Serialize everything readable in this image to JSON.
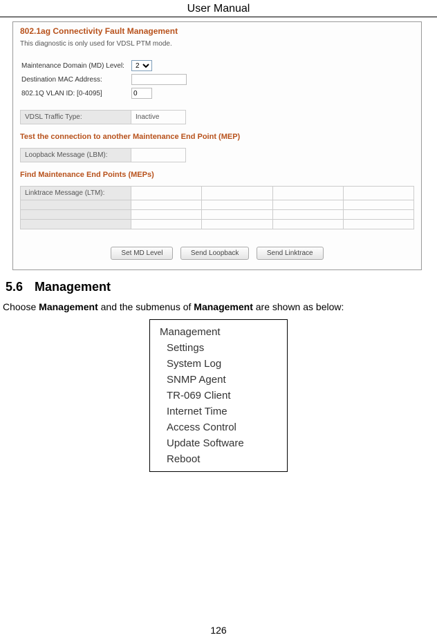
{
  "header": "User Manual",
  "panel": {
    "title": "802.1ag Connectivity Fault Management",
    "note": "This diagnostic is only used for VDSL PTM mode.",
    "fields": {
      "md_level_label": "Maintenance Domain (MD) Level:",
      "md_level_value": "2",
      "dest_mac_label": "Destination MAC Address:",
      "dest_mac_value": "",
      "vlan_label": "802.1Q VLAN ID: [0-4095]",
      "vlan_value": "0",
      "vdsl_type_label": "VDSL Traffic Type:",
      "vdsl_type_value": "Inactive"
    },
    "section_test": "Test the connection to another Maintenance End Point (MEP)",
    "lbm_label": "Loopback Message (LBM):",
    "lbm_value": "",
    "section_find": "Find Maintenance End Points (MEPs)",
    "ltm_label": "Linktrace Message (LTM):",
    "buttons": {
      "set_md": "Set MD Level",
      "send_loopback": "Send Loopback",
      "send_linktrace": "Send Linktrace"
    }
  },
  "section": {
    "number": "5.6",
    "title": "Management",
    "text_pre": "Choose ",
    "text_bold1": "Management",
    "text_mid": " and the submenus of ",
    "text_bold2": "Management",
    "text_post": " are shown as below:"
  },
  "submenu": {
    "title": "Management",
    "items": [
      "Settings",
      "System Log",
      "SNMP Agent",
      "TR-069 Client",
      "Internet Time",
      "Access Control",
      "Update Software",
      "Reboot"
    ]
  },
  "page_number": "126"
}
